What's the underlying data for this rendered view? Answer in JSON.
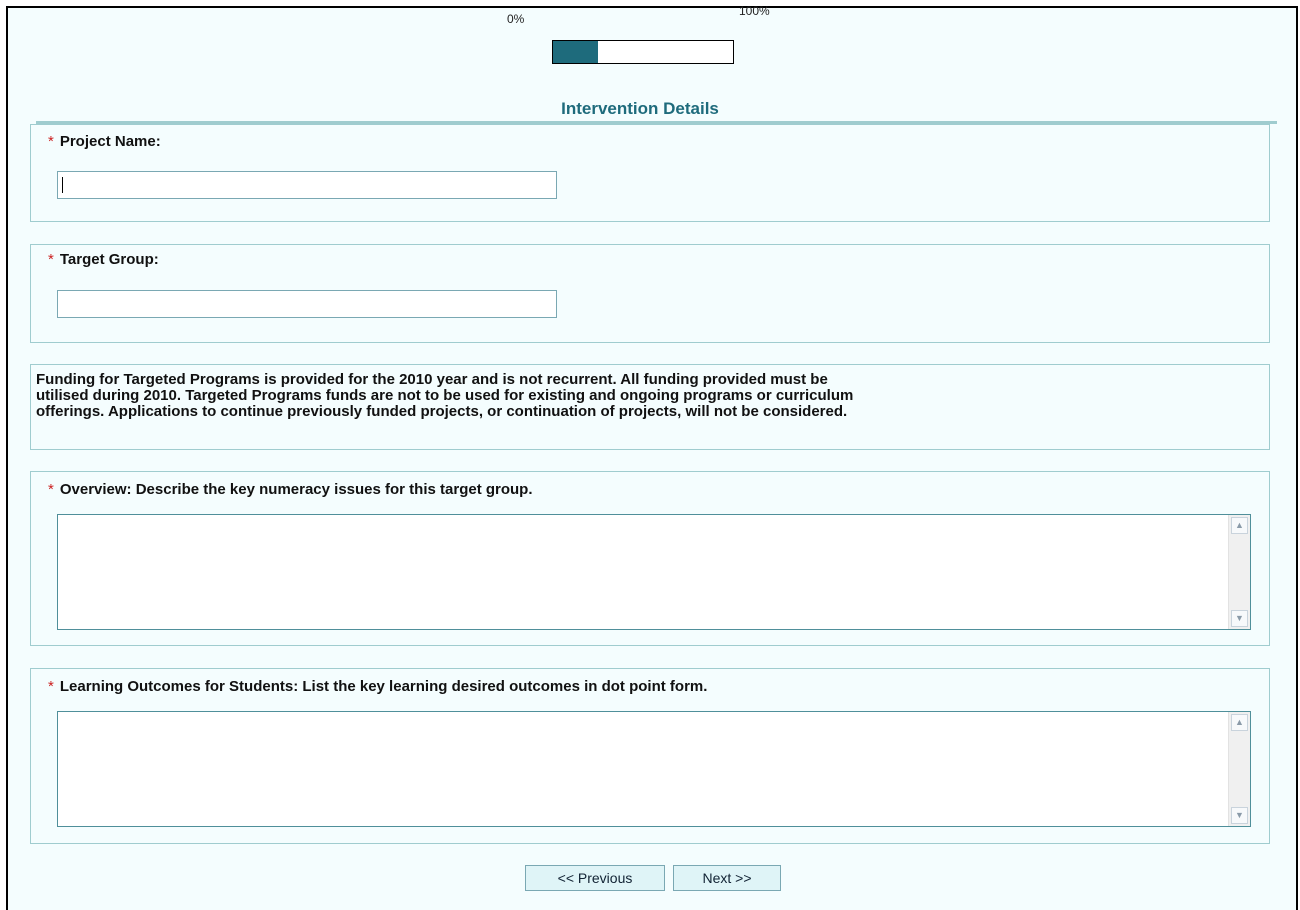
{
  "progress": {
    "min_label": "0%",
    "max_label": "100%",
    "value_percent": 25
  },
  "section_title": "Intervention Details",
  "fields": {
    "project_name": {
      "required_marker": "*",
      "label": "Project Name:",
      "value": ""
    },
    "target_group": {
      "required_marker": "*",
      "label": "Target Group:",
      "value": ""
    },
    "overview": {
      "required_marker": "*",
      "label": "Overview: Describe the key numeracy issues for this target group.",
      "value": ""
    },
    "learning_outcomes": {
      "required_marker": "*",
      "label": "Learning Outcomes for Students: List the key learning desired outcomes in dot point form.",
      "value": ""
    }
  },
  "notice": {
    "line1": "Funding for Targeted Programs is provided for the 2010 year and is not recurrent. All funding provided must be",
    "line2": "utilised during 2010. Targeted Programs funds are not to be used for existing and ongoing programs or curriculum",
    "line3": "offerings. Applications to continue previously funded projects, or continuation of projects, will not be considered."
  },
  "navigation": {
    "previous_label": "<< Previous",
    "next_label": "Next >>"
  },
  "colors": {
    "accent": "#1e6b7c",
    "required": "#cc2222",
    "panel_border": "#9fcccf",
    "background": "#f4fdfe"
  },
  "icons": {
    "scroll_up": "scroll-up-arrow-icon",
    "scroll_down": "scroll-down-arrow-icon"
  }
}
